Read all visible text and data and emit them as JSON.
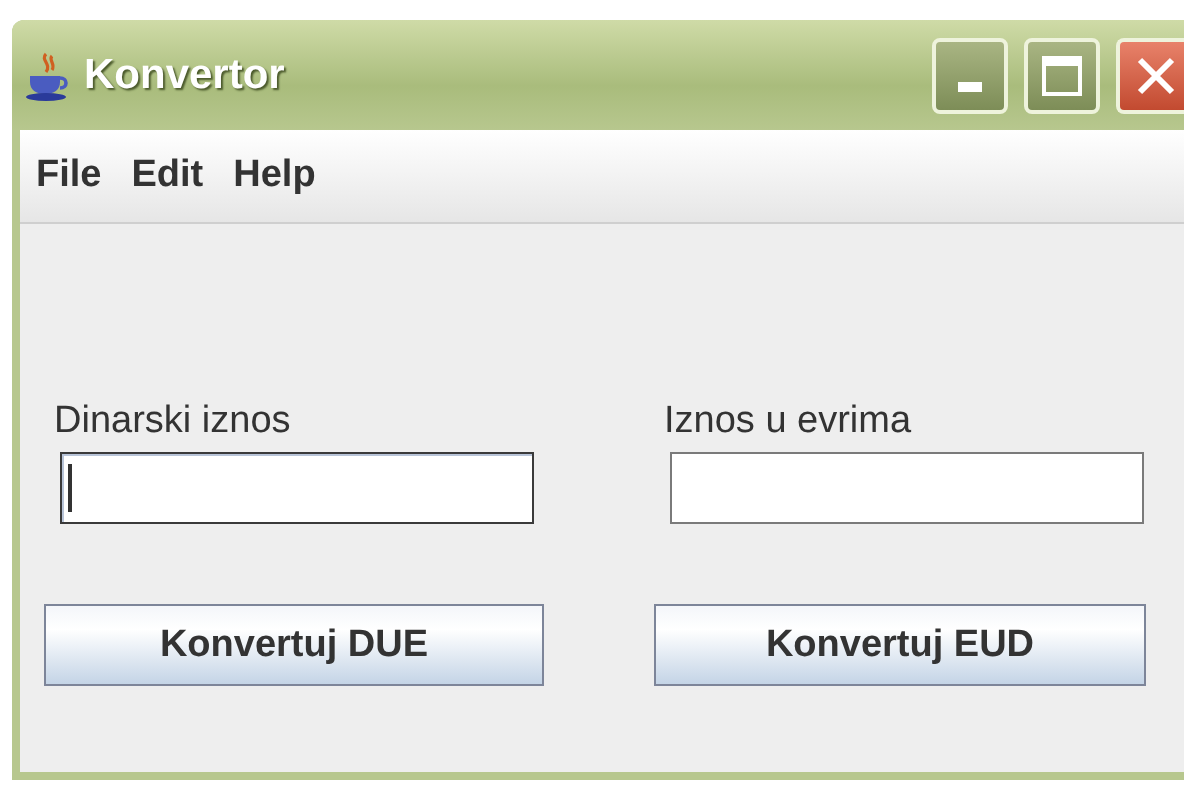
{
  "window": {
    "title": "Konvertor"
  },
  "menu": [
    "File",
    "Edit",
    "Help"
  ],
  "fields": [
    {
      "label": "Dinarski iznos",
      "focused": true
    },
    {
      "label": "Iznos u evrima",
      "focused": false
    }
  ],
  "buttons": [
    "Konvertuj DUE",
    "Konvertuj EUD"
  ]
}
